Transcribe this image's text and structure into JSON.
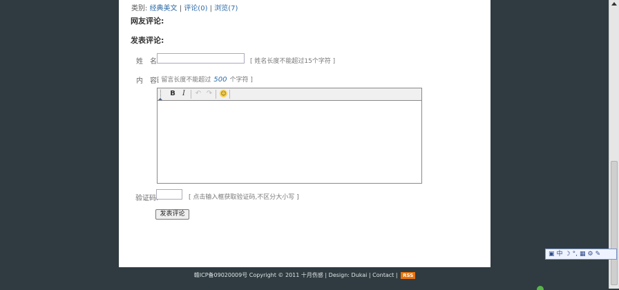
{
  "meta": {
    "category_label": "类别:",
    "category_value": "经典美文",
    "sep1": "|",
    "comments_link": "评论(0)",
    "sep2": "|",
    "views_link": "浏览(7)"
  },
  "sections": {
    "comments_title": "网友评论:",
    "post_title": "发表评论:"
  },
  "form": {
    "name_label": "姓　名:",
    "name_hint": "[ 姓名长度不能超过15个字符 ]",
    "content_label": "内　容:",
    "content_hint_pre": "[ 留言长度不能超过",
    "content_max": "500",
    "content_hint_post": "个字符 ]",
    "captcha_label": "验证码:",
    "captcha_hint": "[ 点击输入框获取验证码,不区分大小写 ]",
    "submit_label": "发表评论"
  },
  "toolbar": {
    "bold": "B",
    "italic": "I",
    "undo": "↶",
    "redo": "↷",
    "smiley": "☺"
  },
  "footer": {
    "icp": "赣ICP备09020009号",
    "copyright": "Copyright © 2011 十月伤感",
    "design_label": "| Design:",
    "design_value": "Dukai",
    "contact": "Contact",
    "rss": "RSS"
  },
  "ime": {
    "items": [
      "中",
      "☽",
      "°,",
      "▦",
      "⚙",
      "✎"
    ]
  },
  "colors": {
    "background": "#2f3b40",
    "link": "#2d6aa8",
    "rss": "#e8730b"
  }
}
